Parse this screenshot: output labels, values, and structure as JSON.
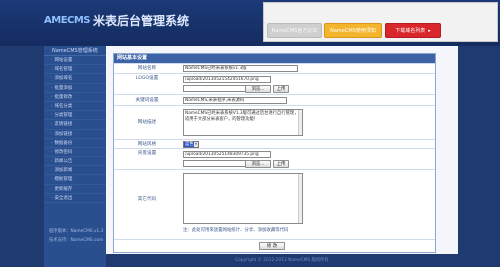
{
  "header": {
    "logo_mark": "AMECMS",
    "title": "米表后台管理系统",
    "links": [
      {
        "label": "NameCMS官方论坛"
      },
      {
        "label": "NameCMS使用须知"
      },
      {
        "label": "下载域名列表",
        "arrow": "▸"
      }
    ]
  },
  "sidebar": {
    "head": "NameCMS管理系统",
    "items": [
      "网站设置",
      "域名管理",
      "添加域名",
      "批量添加",
      "批量修改",
      "域名分类",
      "分类管理",
      "友情链接",
      "添加链接",
      "数据备份",
      "修改密码",
      "新闻公告",
      "添加新闻",
      "模板管理",
      "更新缓存",
      "安全退出"
    ],
    "footer": [
      "程序版本：NameCMS v1.3",
      "技术支持：NameCMS.com"
    ]
  },
  "form": {
    "panel_title": "网站基本设置",
    "rows": [
      {
        "label": "网站名称",
        "value": "NameCMS已经米表系统v1.3版"
      },
      {
        "label": "LOGO设置",
        "value": "/upload/20130521542451670.png",
        "browse": "浏览...",
        "upload": "上传"
      },
      {
        "label": "关键词设置",
        "value": "NameCMS,米表程序,米表源码"
      },
      {
        "label": "网站描述",
        "value": "NameCMS已经米表系统V1.3版可通过后台进行自行管理，适用于大部分米表客户，的管理功能！"
      },
      {
        "label": "网站风格",
        "value": "蓝色"
      },
      {
        "label": "背景设置",
        "value": "/upload/20130525148309735.png",
        "browse": "浏览...",
        "upload": "上传"
      },
      {
        "label": "其它代码",
        "value": "",
        "note": "注：此处可用来放置网站统计、分享、添加收藏等代码"
      }
    ],
    "submit": "修 改"
  },
  "footer": "Copyright © 2012-2013 NameCMS 版权所有"
}
